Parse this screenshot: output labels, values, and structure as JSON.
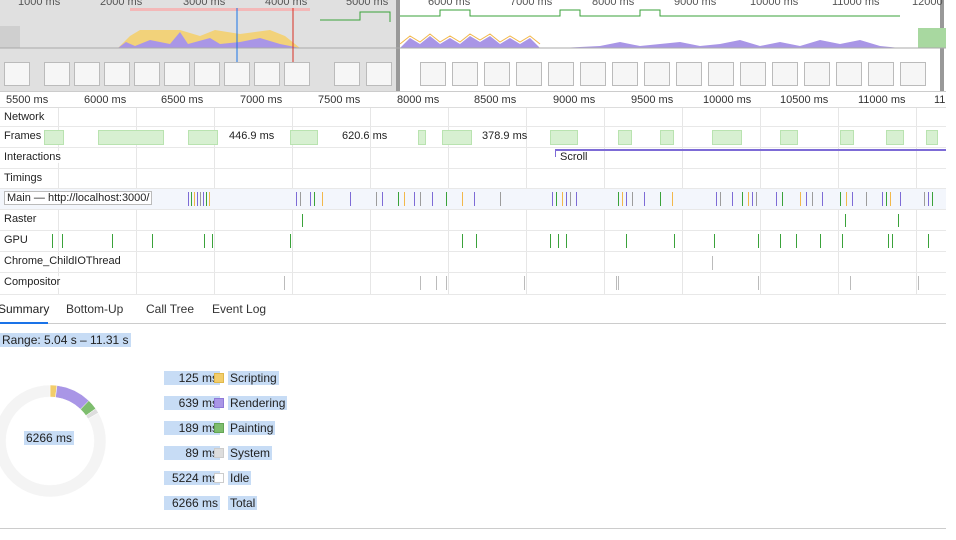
{
  "overview": {
    "ticks": [
      "1000 ms",
      "2000 ms",
      "3000 ms",
      "4000 ms",
      "5000 ms",
      "6000 ms",
      "7000 ms",
      "8000 ms",
      "9000 ms",
      "10000 ms",
      "11000 ms",
      "12000"
    ]
  },
  "ruler": {
    "ticks": [
      "5500 ms",
      "6000 ms",
      "6500 ms",
      "7000 ms",
      "7500 ms",
      "8000 ms",
      "8500 ms",
      "9000 ms",
      "9500 ms",
      "10000 ms",
      "10500 ms",
      "11000 ms",
      "11"
    ]
  },
  "tracks": {
    "network": "Network",
    "frames": "Frames",
    "frame_gaps": [
      "446.9 ms",
      "620.6 ms",
      "378.9 ms"
    ],
    "interactions": "Interactions",
    "scroll": "Scroll",
    "timings": "Timings",
    "main": "Main — http://localhost:3000/",
    "raster": "Raster",
    "gpu": "GPU",
    "childio": "Chrome_ChildIOThread",
    "compositor": "Compositor"
  },
  "tabs": [
    "Summary",
    "Bottom-Up",
    "Call Tree",
    "Event Log"
  ],
  "summary": {
    "range": "Range: 5.04 s – 11.31 s",
    "total_center": "6266 ms",
    "rows": [
      {
        "value": "125 ms",
        "name": "Scripting",
        "color": "#f2cd6b",
        "ms": 125
      },
      {
        "value": "639 ms",
        "name": "Rendering",
        "color": "#a996e6",
        "ms": 639
      },
      {
        "value": "189 ms",
        "name": "Painting",
        "color": "#7ebd6e",
        "ms": 189
      },
      {
        "value": "89 ms",
        "name": "System",
        "color": "#dddddd",
        "ms": 89
      },
      {
        "value": "5224 ms",
        "name": "Idle",
        "color": "#ffffff",
        "ms": 5224
      },
      {
        "value": "6266 ms",
        "name": "Total",
        "color": "",
        "ms": 0
      }
    ]
  }
}
